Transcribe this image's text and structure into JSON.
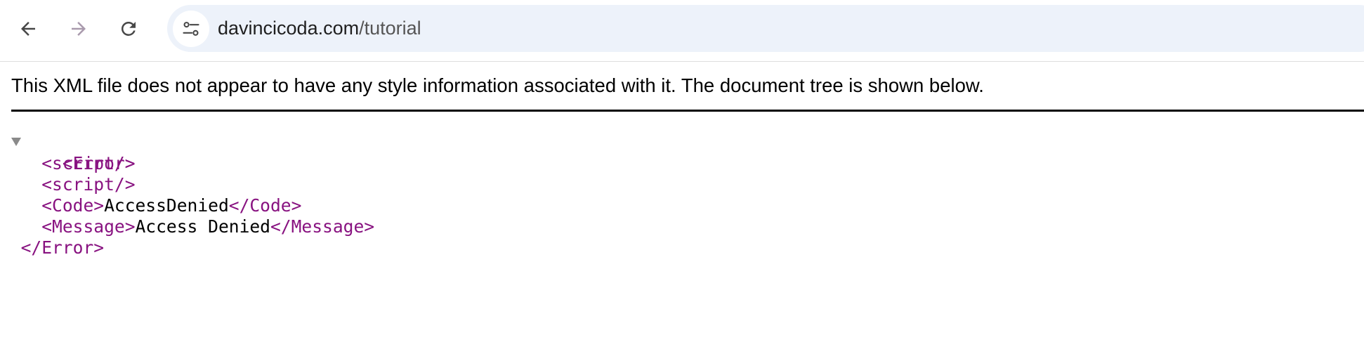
{
  "browser": {
    "url_host": "davincicoda.com",
    "url_path": "/tutorial",
    "icons": {
      "back": "arrow-left-icon",
      "forward": "arrow-right-icon",
      "reload": "reload-icon",
      "site_info": "tune-icon"
    },
    "colors": {
      "omnibox_bg": "#edf2fa",
      "icon_active": "#474747",
      "icon_disabled": "#a99aad"
    }
  },
  "page": {
    "notice": "This XML file does not appear to have any style information associated with it. The document tree is shown below."
  },
  "xml": {
    "error_open": "<Error>",
    "script_1": "<script/>",
    "script_2": "<script/>",
    "code_open": "<Code>",
    "code_value": "AccessDenied",
    "code_close": "</Code>",
    "message_open": "<Message>",
    "message_value": "Access Denied",
    "message_close": "</Message>",
    "error_close": "</Error>",
    "colors": {
      "tag": "#881280",
      "text": "#000000"
    }
  }
}
